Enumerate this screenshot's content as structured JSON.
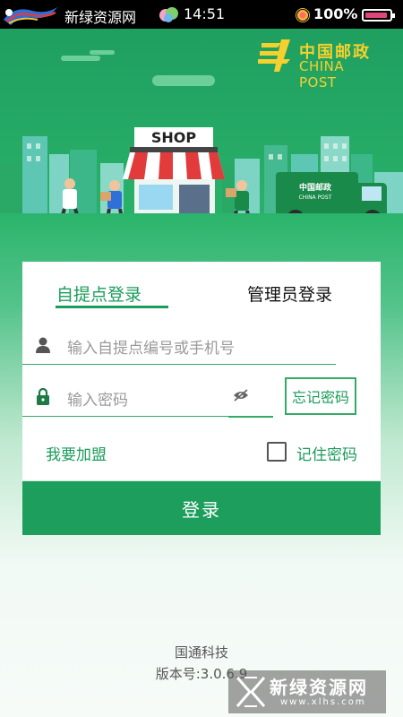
{
  "status_bar": {
    "app_name": "新绿资源网",
    "time": "14:51",
    "battery": "100%",
    "icons": [
      "app-logo-icon",
      "weather-icon",
      "signal-icon",
      "battery-icon"
    ]
  },
  "brand": {
    "logo_cn": "中国邮政",
    "logo_en": "CHINA POST",
    "shop_sign": "SHOP",
    "truck_label_cn": "中国邮政",
    "truck_label_en": "CHINA POST"
  },
  "login": {
    "tabs": [
      {
        "label": "自提点登录",
        "active": true
      },
      {
        "label": "管理员登录",
        "active": false
      }
    ],
    "account_placeholder": "输入自提点编号或手机号",
    "password_placeholder": "输入密码",
    "forgot_label": "忘记密码",
    "join_label": "我要加盟",
    "remember_label": "记住密码",
    "remember_checked": false,
    "submit_label": "登录"
  },
  "footer": {
    "company": "国通科技",
    "version": "版本号:3.0.6.9"
  },
  "watermark": {
    "title": "新绿资源网",
    "url": "www.xlhs.com"
  },
  "colors": {
    "brand_green": "#1e9e5d",
    "accent_yellow": "#f6d12d"
  }
}
